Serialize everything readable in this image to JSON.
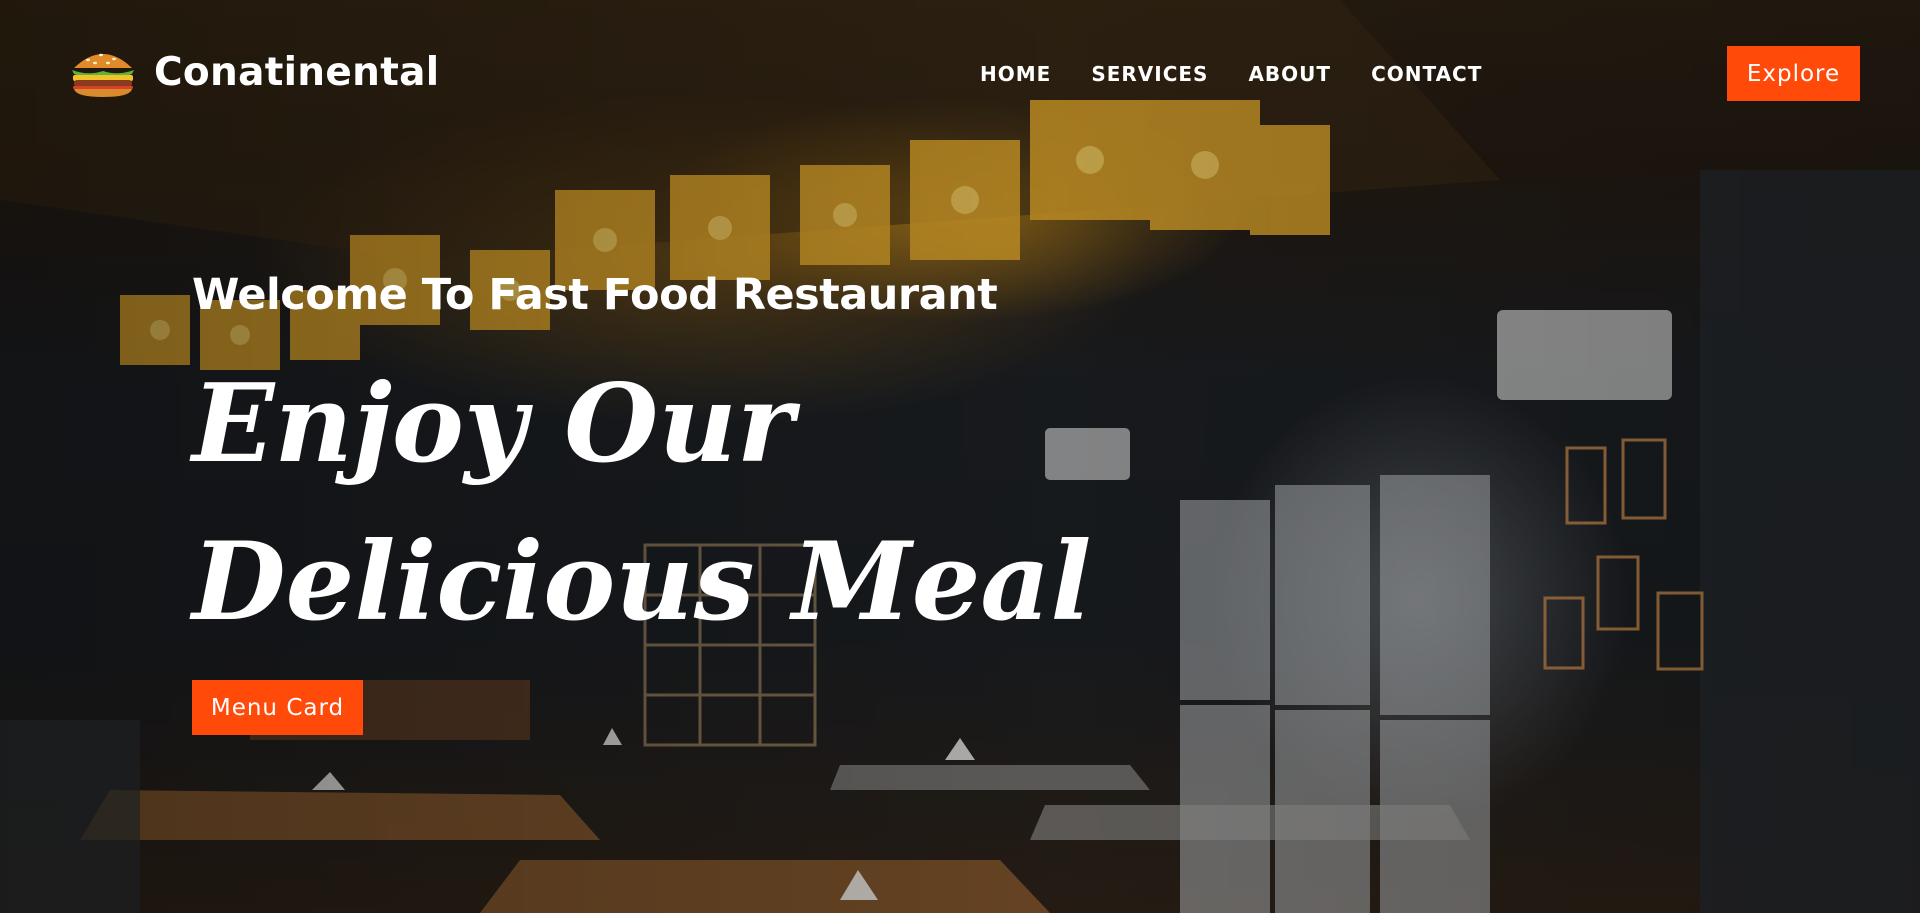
{
  "brand": {
    "name": "Conatinental",
    "icon": "burger-icon"
  },
  "nav": {
    "items": [
      {
        "label": "HOME"
      },
      {
        "label": "SERVICES"
      },
      {
        "label": "ABOUT"
      },
      {
        "label": "CONTACT"
      }
    ]
  },
  "header": {
    "cta_label": "Explore"
  },
  "hero": {
    "welcome": "Welcome To Fast Food Restaurant",
    "headline_line1": "Enjoy Our",
    "headline_line2": "Delicious Meal",
    "cta_label": "Menu Card"
  },
  "colors": {
    "accent": "#ff4a0a",
    "text": "#ffffff",
    "background": "#14171b"
  }
}
